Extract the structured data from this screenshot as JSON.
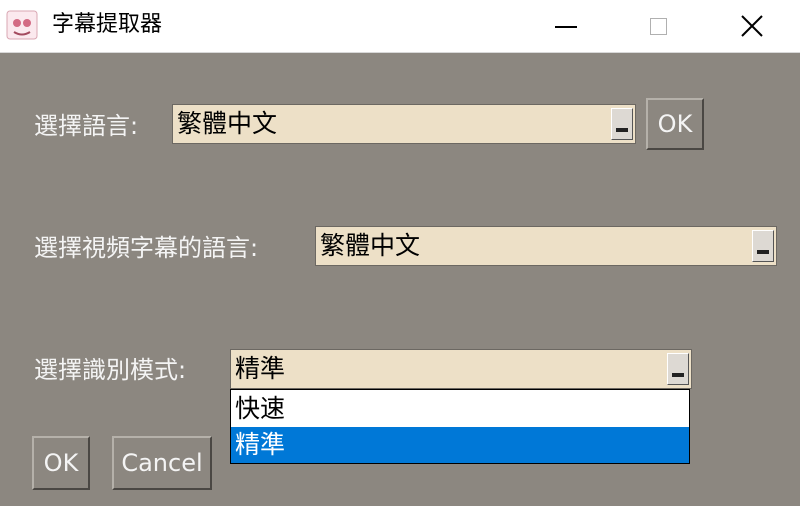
{
  "window": {
    "title": "字幕提取器",
    "icon": "app-icon",
    "controls": [
      "minimize-icon",
      "maximize-icon",
      "close-icon"
    ]
  },
  "language_row": {
    "label": "選擇語言:",
    "value": "繁體中文",
    "ok_label": "OK"
  },
  "subtitle_language_row": {
    "label": "選擇視頻字幕的語言:",
    "value": "繁體中文"
  },
  "mode_row": {
    "label": "選擇識別模式:",
    "value": "精準",
    "options": [
      "快速",
      "精準"
    ],
    "highlighted_option": "精準"
  },
  "buttons": {
    "ok_label": "OK",
    "cancel_label": "Cancel"
  },
  "colors": {
    "background": "#8c8780",
    "combo_background": "#ede0c7",
    "highlight": "#0078d7"
  }
}
